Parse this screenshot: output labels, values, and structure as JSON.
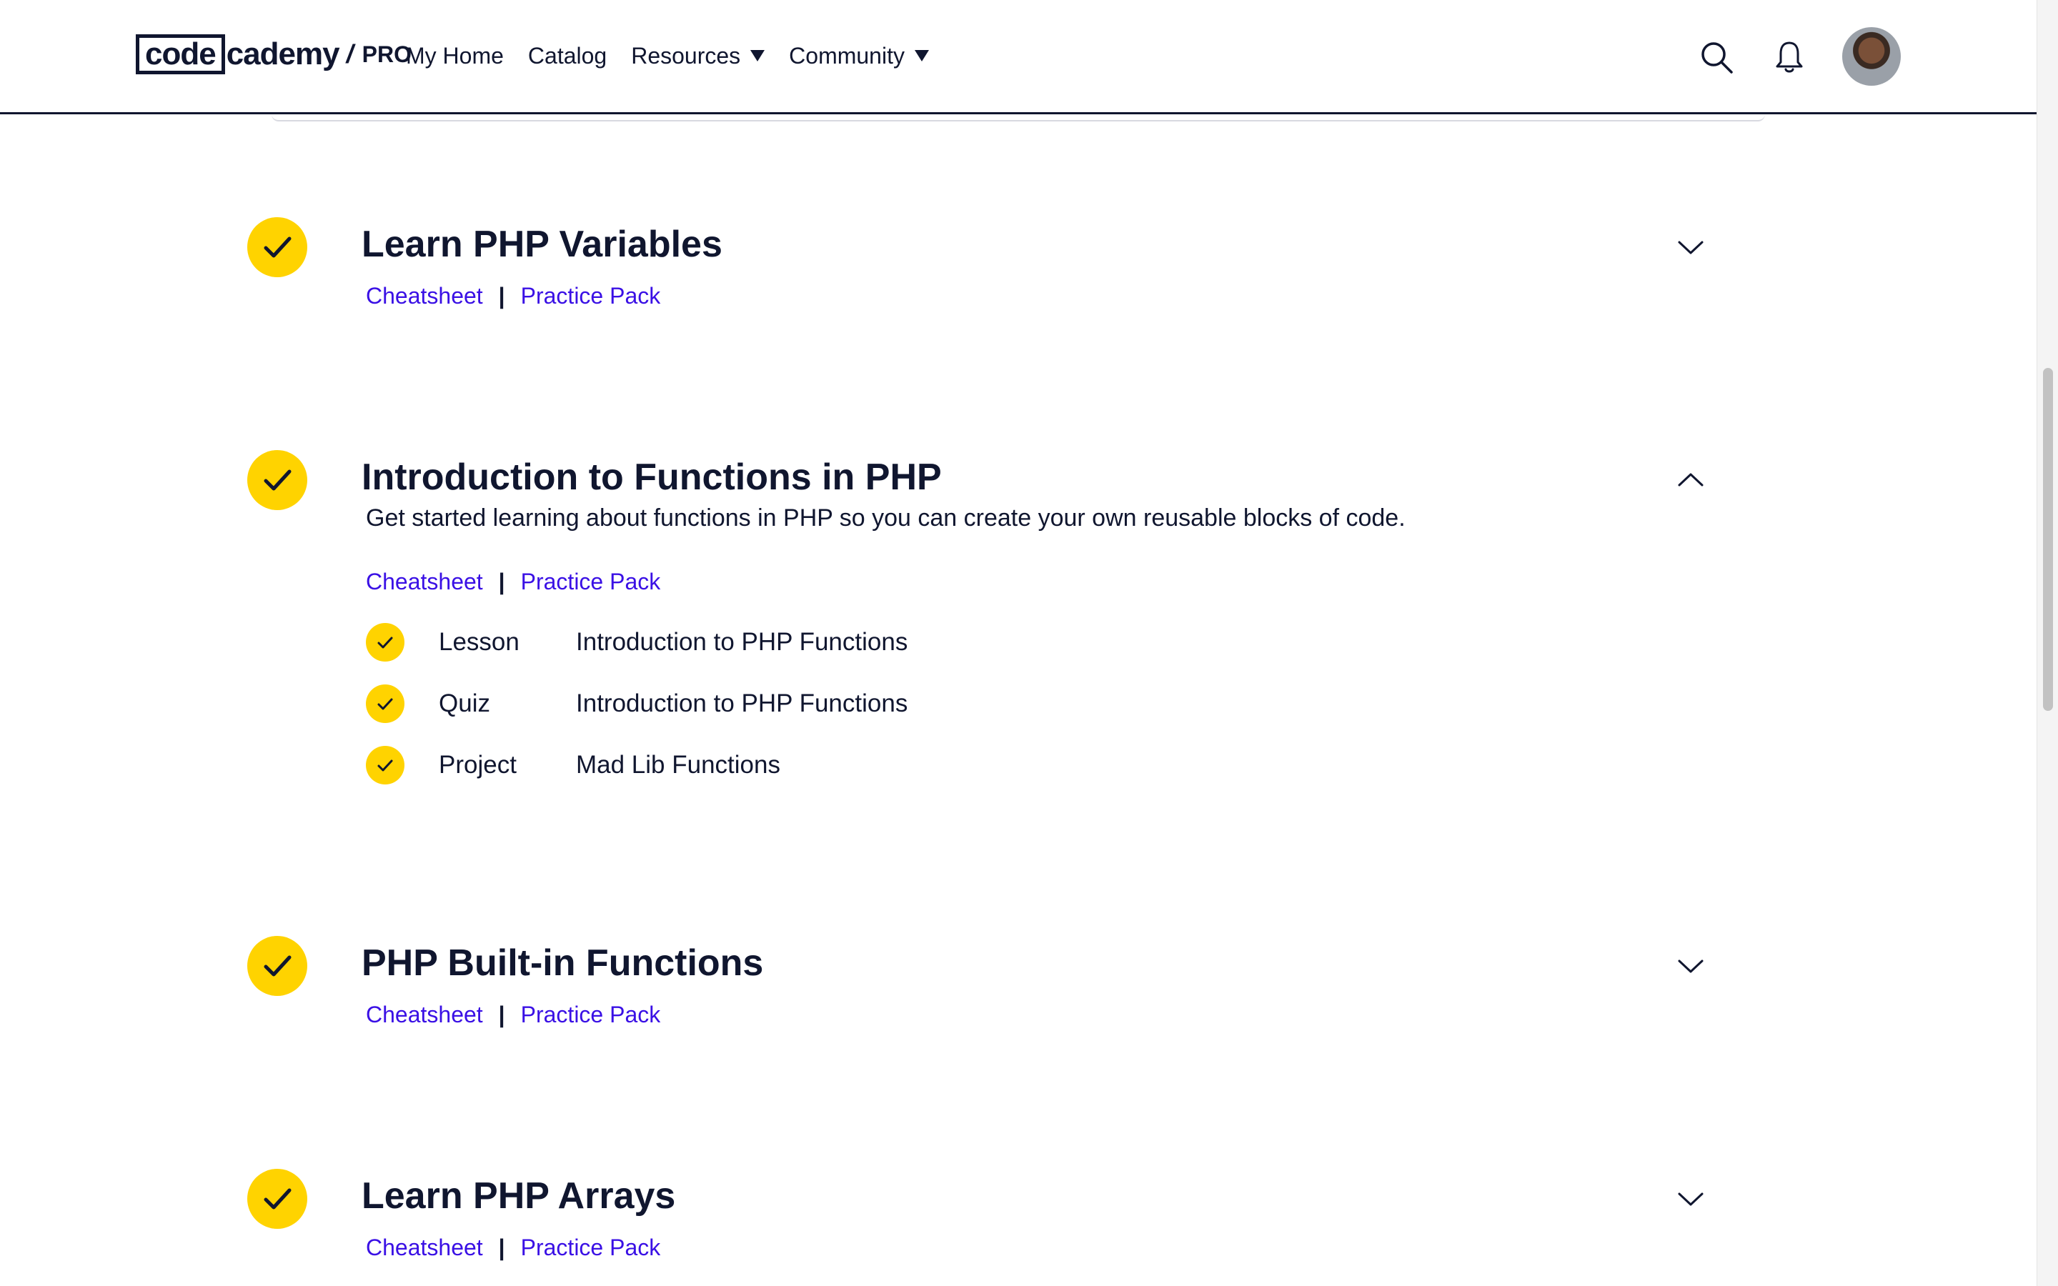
{
  "header": {
    "logo": {
      "code": "code",
      "academy": "cademy",
      "slash": "/",
      "pro": "PRO"
    },
    "nav": [
      {
        "label": "My Home"
      },
      {
        "label": "Catalog"
      },
      {
        "label": "Resources",
        "dropdown": true
      },
      {
        "label": "Community",
        "dropdown": true
      }
    ],
    "icons": [
      "search-icon",
      "bell-icon",
      "avatar"
    ]
  },
  "colors": {
    "accent_yellow": "#ffd300",
    "link": "#3a10e5",
    "text": "#10162f"
  },
  "modules": [
    {
      "title": "Learn PHP Variables",
      "expanded": false,
      "links": {
        "cheatsheet": "Cheatsheet",
        "separator": "|",
        "practice": "Practice Pack"
      }
    },
    {
      "title": "Introduction to Functions in PHP",
      "expanded": true,
      "description": "Get started learning about functions in PHP so you can create your own reusable blocks of code.",
      "links": {
        "cheatsheet": "Cheatsheet",
        "separator": "|",
        "practice": "Practice Pack"
      },
      "items": [
        {
          "type": "Lesson",
          "name": "Introduction to PHP Functions"
        },
        {
          "type": "Quiz",
          "name": "Introduction to PHP Functions"
        },
        {
          "type": "Project",
          "name": "Mad Lib Functions"
        }
      ]
    },
    {
      "title": "PHP Built-in Functions",
      "expanded": false,
      "links": {
        "cheatsheet": "Cheatsheet",
        "separator": "|",
        "practice": "Practice Pack"
      }
    },
    {
      "title": "Learn PHP Arrays",
      "expanded": false,
      "links": {
        "cheatsheet": "Cheatsheet",
        "separator": "|",
        "practice": "Practice Pack"
      }
    }
  ]
}
